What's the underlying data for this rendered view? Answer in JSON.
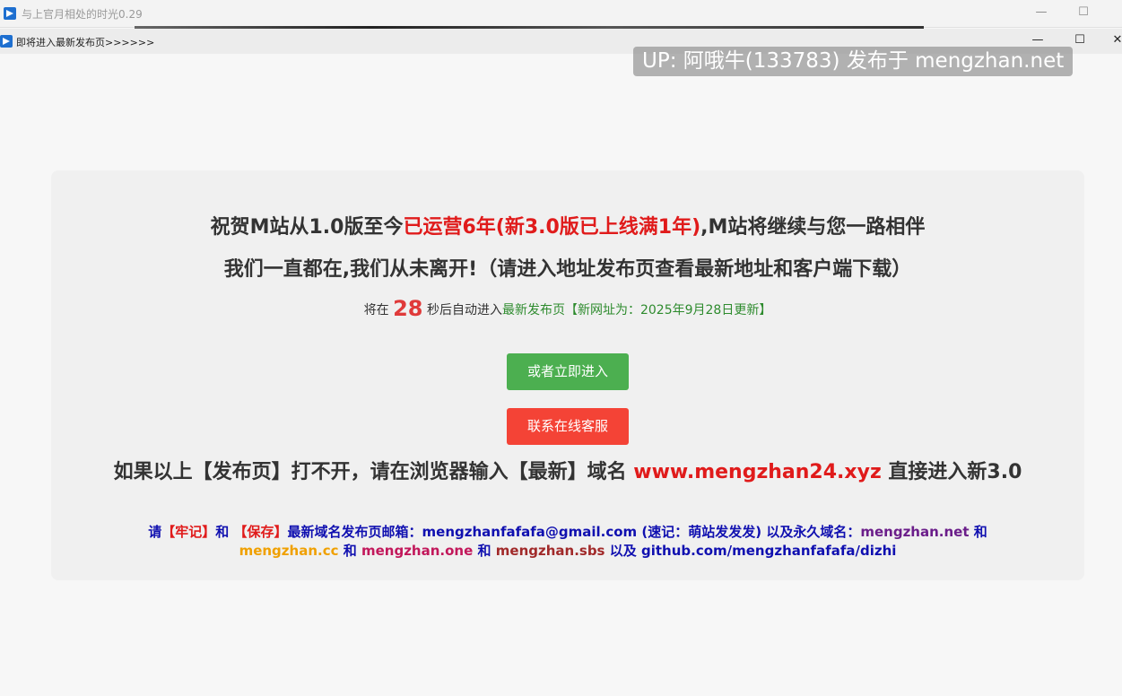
{
  "outer_window": {
    "title": "与上官月相处的时光0.29",
    "minimize": "—",
    "maximize": "☐"
  },
  "inner_window": {
    "title": "即将进入最新发布页>>>>>>",
    "minimize": "—",
    "maximize": "☐",
    "close": "✕"
  },
  "watermark": "UP: 阿哦牛(133783) 发布于 mengzhan.net",
  "card": {
    "line1_prefix": "祝贺M站从1.0版至今",
    "line1_highlight": "已运营6年(新3.0版已上线满1年)",
    "line1_suffix": ",M站将继续与您一路相伴",
    "line2": "我们一直都在,我们从未离开!（请进入地址发布页查看最新地址和客户端下载）",
    "countdown_prefix": "将在",
    "countdown_value": "28",
    "countdown_mid": "秒后自动进入",
    "countdown_link": "最新发布页【新网址为：2025年9月28日更新】",
    "enter_button": "或者立即进入",
    "service_button": "联系在线客服",
    "domain_prefix": "如果以上【发布页】打不开，请在浏览器输入【最新】域名",
    "domain_value": "www.mengzhan24.xyz",
    "domain_suffix": "直接进入新3.0",
    "info": {
      "please": "请",
      "remember": "【牢记】",
      "and1": "和",
      "save": "【保存】",
      "email_text": "最新域名发布页邮箱：mengzhanfafafa@gmail.com (速记：萌站发发发) 以及永久域名：",
      "domain_net": "mengzhan.net",
      "and2": "和",
      "domain_cc": "mengzhan.cc",
      "and3": "和",
      "domain_one": "mengzhan.one",
      "and4": "和",
      "domain_sbs": "mengzhan.sbs",
      "also": "以及",
      "github": "github.com/mengzhanfafafa/dizhi"
    }
  },
  "colors": {
    "accent_red": "#e01b1b",
    "button_green": "#4caf50",
    "button_red": "#f44336",
    "link_blue": "#1010b0",
    "text_green": "#2e8b2e"
  }
}
